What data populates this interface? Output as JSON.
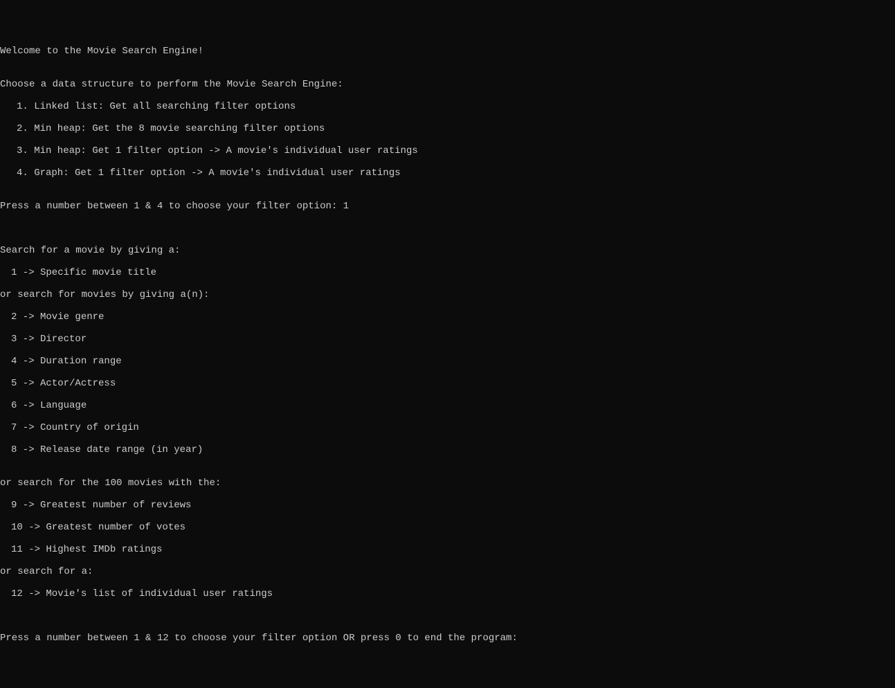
{
  "welcome": "Welcome to the Movie Search Engine!",
  "blank": "",
  "ds_prompt": "Choose a data structure to perform the Movie Search Engine:",
  "ds_options": [
    "1. Linked list: Get all searching filter options",
    "2. Min heap: Get the 8 movie searching filter options",
    "3. Min heap: Get 1 filter option -> A movie's individual user ratings",
    "4. Graph: Get 1 filter option -> A movie's individual user ratings"
  ],
  "ds_input_prompt": "Press a number between 1 & 4 to choose your filter option: 1",
  "search_header1": "Search for a movie by giving a:",
  "search_opts1": [
    "1 -> Specific movie title"
  ],
  "search_header2": "or search for movies by giving a(n):",
  "search_opts2": [
    "2 -> Movie genre",
    "3 -> Director",
    "4 -> Duration range",
    "5 -> Actor/Actress",
    "6 -> Language",
    "7 -> Country of origin",
    "8 -> Release date range (in year)"
  ],
  "search_header3": "or search for the 100 movies with the:",
  "search_opts3": [
    "9 -> Greatest number of reviews",
    "10 -> Greatest number of votes",
    "11 -> Highest IMDb ratings"
  ],
  "search_header4": "or search for a:",
  "search_opts4": [
    "12 -> Movie's list of individual user ratings"
  ],
  "final_prompt": "Press a number between 1 & 12 to choose your filter option OR press 0 to end the program: "
}
